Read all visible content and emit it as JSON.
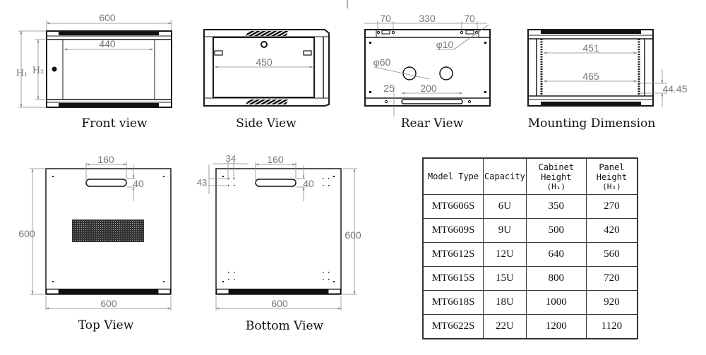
{
  "views": {
    "front": {
      "caption": "Front view",
      "dims": {
        "width": "600",
        "inner_width": "440",
        "h1": "H₁",
        "h2": "H₂"
      }
    },
    "side": {
      "caption": "Side View",
      "dims": {
        "depth": "450"
      }
    },
    "rear": {
      "caption": "Rear View",
      "dims": {
        "left": "70",
        "middle": "330",
        "right": "70",
        "hole_small": "φ10",
        "hole_large": "φ60",
        "slot_offset": "25",
        "slot_length": "200"
      }
    },
    "mounting": {
      "caption": "Mounting Dimension",
      "dims": {
        "inner": "451",
        "outer": "465",
        "unit": "44.45"
      }
    },
    "top": {
      "caption": "Top View",
      "dims": {
        "handle_width": "160",
        "handle_height": "40",
        "depth": "600",
        "width": "600"
      }
    },
    "bottom": {
      "caption": "Bottom View",
      "dims": {
        "hole_spacing_x": "34",
        "hole_spacing_y": "43",
        "handle_width": "160",
        "handle_height": "40",
        "depth": "600",
        "width": "600"
      }
    }
  },
  "spec_table": {
    "headers": {
      "model": "Model Type",
      "capacity": "Capacity",
      "cabinet_height": "Cabinet Height",
      "cabinet_height_sub": "(H₁)",
      "panel_height": "Panel Height",
      "panel_height_sub": "(H₂)"
    },
    "rows": [
      {
        "model": "MT6606S",
        "capacity": "6U",
        "cabinet_height": "350",
        "panel_height": "270"
      },
      {
        "model": "MT6609S",
        "capacity": "9U",
        "cabinet_height": "500",
        "panel_height": "420"
      },
      {
        "model": "MT6612S",
        "capacity": "12U",
        "cabinet_height": "640",
        "panel_height": "560"
      },
      {
        "model": "MT6615S",
        "capacity": "15U",
        "cabinet_height": "800",
        "panel_height": "720"
      },
      {
        "model": "MT6618S",
        "capacity": "18U",
        "cabinet_height": "1000",
        "panel_height": "920"
      },
      {
        "model": "MT6622S",
        "capacity": "22U",
        "cabinet_height": "1200",
        "panel_height": "1120"
      }
    ]
  }
}
